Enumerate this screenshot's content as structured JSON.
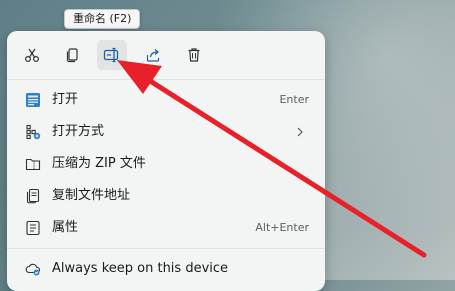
{
  "tooltip": {
    "text": "重命名 (F2)"
  },
  "toolbar": {
    "cut_icon": "scissors-icon",
    "copy_icon": "copy-icon",
    "rename_icon": "rename-icon",
    "share_icon": "share-icon",
    "delete_icon": "trash-icon"
  },
  "menu": {
    "items": [
      {
        "label": "打开",
        "shortcut": "Enter",
        "icon": "open-app-icon"
      },
      {
        "label": "打开方式",
        "shortcut": "",
        "icon": "open-with-icon",
        "has_submenu": true
      },
      {
        "label": "压缩为 ZIP 文件",
        "shortcut": "",
        "icon": "zip-folder-icon"
      },
      {
        "label": "复制文件地址",
        "shortcut": "",
        "icon": "copy-path-icon"
      },
      {
        "label": "属性",
        "shortcut": "Alt+Enter",
        "icon": "properties-icon"
      },
      {
        "label": "Always keep on this device",
        "shortcut": "",
        "icon": "cloud-sync-icon"
      }
    ]
  },
  "annotation": {
    "arrow_color": "#e8202a"
  }
}
